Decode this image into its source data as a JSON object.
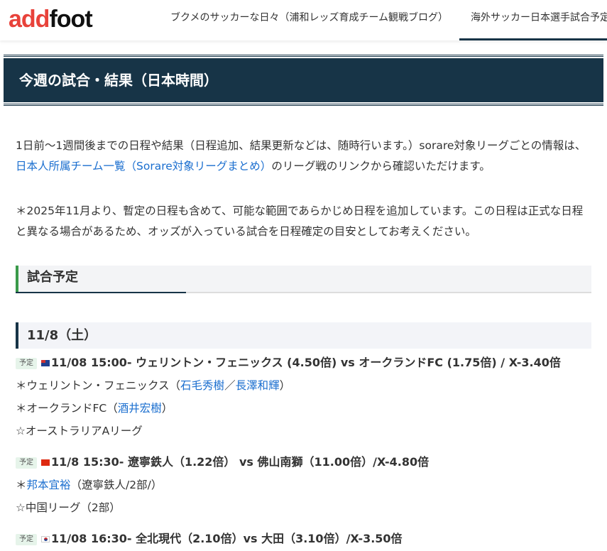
{
  "header": {
    "logo_red": "add",
    "logo_black": "foot",
    "nav": [
      "ブクメのサッカーな日々（浦和レッズ育成チーム観戦ブログ）",
      "海外サッカー日本選手試合予定&"
    ]
  },
  "title": "今週の試合・結果（日本時間）",
  "intro": {
    "p1_a": "1日前〜1週間後までの日程や結果（日程追加、結果更新などは、随時行います。）sorare対象リーグごとの情報は、",
    "p1_link": "日本人所属チーム一覧（Sorare対象リーグまとめ）",
    "p1_b": "のリーグ戦のリンクから確認いただけます。",
    "p2": "＊2025年11月より、暫定の日程も含めて、可能な範囲であらかじめ日程を追加しています。この日程は正式な日程と異なる場合があるため、オッズが入っている試合を日程確定の目安としてお考えください。"
  },
  "section_heading": "試合予定",
  "date_heading": "11/8（土）",
  "badge": "予定",
  "matches": [
    {
      "flag": "australia",
      "title": "11/08 15:00- ウェリントン・フェニックス (4.50倍) vs オークランドFC (1.75倍) / X-3.40倍",
      "l1_pre": "＊ウェリントン・フェニックス（",
      "l1_link1": "石毛秀樹",
      "l1_sep": "／",
      "l1_link2": "長澤和輝",
      "l1_post": "）",
      "l2_pre": "＊オークランドFC（",
      "l2_link": "酒井宏樹",
      "l2_post": "）",
      "league": "☆オーストラリアAリーグ"
    },
    {
      "flag": "china",
      "title": "11/8 15:30- 遼寧鉄人（1.22倍） vs 佛山南獅（11.00倍）/X-4.80倍",
      "l1_pre": "＊",
      "l1_link": "邦本宜裕",
      "l1_post": "（遼寧鉄人/2部/）",
      "league": "☆中国リーグ（2部）"
    },
    {
      "flag": "korea",
      "title": "11/08 16:30- 全北現代（2.10倍）vs 大田（3.10倍）/X-3.50倍"
    }
  ]
}
